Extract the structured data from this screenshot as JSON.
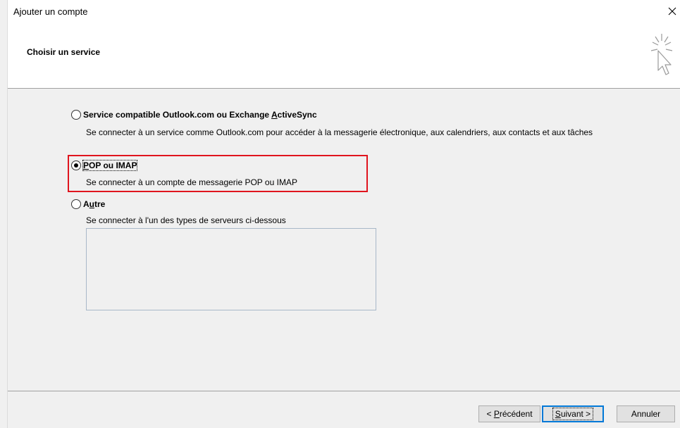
{
  "window": {
    "title": "Ajouter un compte",
    "close_icon": "close-icon"
  },
  "header": {
    "title": "Choisir un service",
    "icon": "cursor-sparkle-icon"
  },
  "options": [
    {
      "label_pre": "Service compatible Outlook.com ou Exchange ",
      "label_mnemonic": "A",
      "label_post": "ctiveSync",
      "description": "Se connecter à un service comme Outlook.com pour accéder à la messagerie électronique, aux calendriers, aux contacts et aux tâches",
      "checked": false
    },
    {
      "label_pre": "",
      "label_mnemonic": "P",
      "label_post": "OP ou IMAP",
      "description": "Se connecter à un compte de messagerie POP ou IMAP",
      "checked": true
    },
    {
      "label_pre": "A",
      "label_mnemonic": "u",
      "label_post": "tre",
      "description": "Se connecter à l'un des types de serveurs ci-dessous",
      "checked": false
    }
  ],
  "colors": {
    "highlight": "#e0141e",
    "default_button_border": "#0078d7"
  },
  "footer": {
    "back": {
      "lt": "< ",
      "mnemonic": "P",
      "rest": "récédent"
    },
    "next": {
      "mnemonic": "S",
      "rest": "uivant >"
    },
    "cancel": "Annuler"
  }
}
